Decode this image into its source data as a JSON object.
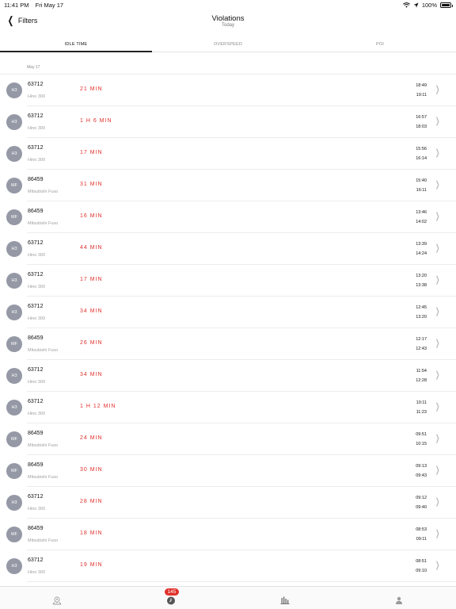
{
  "status_bar": {
    "time": "11:41 PM",
    "date": "Fri May 17",
    "battery_percent": "100%"
  },
  "nav": {
    "back_label": "Filters",
    "title": "Violations",
    "subtitle": "Today"
  },
  "tabs": [
    {
      "label": "IDLE TIME",
      "active": true
    },
    {
      "label": "OVERSPEED",
      "active": false
    },
    {
      "label": "POI",
      "active": false
    }
  ],
  "section_date": "May 17",
  "rows": [
    {
      "avatar": "H3",
      "id": "63712",
      "model": "Hino 300",
      "duration": "21 MIN",
      "start": "18:49",
      "end": "19:11"
    },
    {
      "avatar": "H3",
      "id": "63712",
      "model": "Hino 300",
      "duration": "1 H 6 MIN",
      "start": "16:57",
      "end": "18:03"
    },
    {
      "avatar": "H3",
      "id": "63712",
      "model": "Hino 300",
      "duration": "17 MIN",
      "start": "15:56",
      "end": "16:14"
    },
    {
      "avatar": "MF",
      "id": "86459",
      "model": "Mitsubishi Fuso",
      "duration": "31 MIN",
      "start": "15:40",
      "end": "16:11"
    },
    {
      "avatar": "MF",
      "id": "86459",
      "model": "Mitsubishi Fuso",
      "duration": "16 MIN",
      "start": "13:46",
      "end": "14:02"
    },
    {
      "avatar": "H3",
      "id": "63712",
      "model": "Hino 300",
      "duration": "44 MIN",
      "start": "13:39",
      "end": "14:24"
    },
    {
      "avatar": "H3",
      "id": "63712",
      "model": "Hino 300",
      "duration": "17 MIN",
      "start": "13:20",
      "end": "13:38"
    },
    {
      "avatar": "H3",
      "id": "63712",
      "model": "Hino 300",
      "duration": "34 MIN",
      "start": "12:45",
      "end": "13:20"
    },
    {
      "avatar": "MF",
      "id": "86459",
      "model": "Mitsubishi Fuso",
      "duration": "26 MIN",
      "start": "12:17",
      "end": "12:43"
    },
    {
      "avatar": "H3",
      "id": "63712",
      "model": "Hino 300",
      "duration": "34 MIN",
      "start": "11:54",
      "end": "12:28"
    },
    {
      "avatar": "H3",
      "id": "63712",
      "model": "Hino 300",
      "duration": "1 H 12 MIN",
      "start": "10:11",
      "end": "11:23"
    },
    {
      "avatar": "MF",
      "id": "86459",
      "model": "Mitsubishi Fuso",
      "duration": "24 MIN",
      "start": "09:51",
      "end": "10:15"
    },
    {
      "avatar": "MF",
      "id": "86459",
      "model": "Mitsubishi Fuso",
      "duration": "30 MIN",
      "start": "09:13",
      "end": "09:43"
    },
    {
      "avatar": "H3",
      "id": "63712",
      "model": "Hino 300",
      "duration": "28 MIN",
      "start": "09:12",
      "end": "09:40"
    },
    {
      "avatar": "MF",
      "id": "86459",
      "model": "Mitsubishi Fuso",
      "duration": "18 MIN",
      "start": "08:53",
      "end": "09:11"
    },
    {
      "avatar": "H3",
      "id": "63712",
      "model": "Hino 300",
      "duration": "19 MIN",
      "start": "08:51",
      "end": "09:10"
    }
  ],
  "tab_bar": {
    "items": [
      {
        "icon": "map-pin-icon"
      },
      {
        "icon": "clock-icon",
        "badge": "145"
      },
      {
        "icon": "bar-chart-icon"
      },
      {
        "icon": "user-icon"
      }
    ]
  },
  "colors": {
    "duration_red": "#e0312c",
    "avatar_gray": "#9599a6",
    "badge_red": "#e0312c"
  }
}
